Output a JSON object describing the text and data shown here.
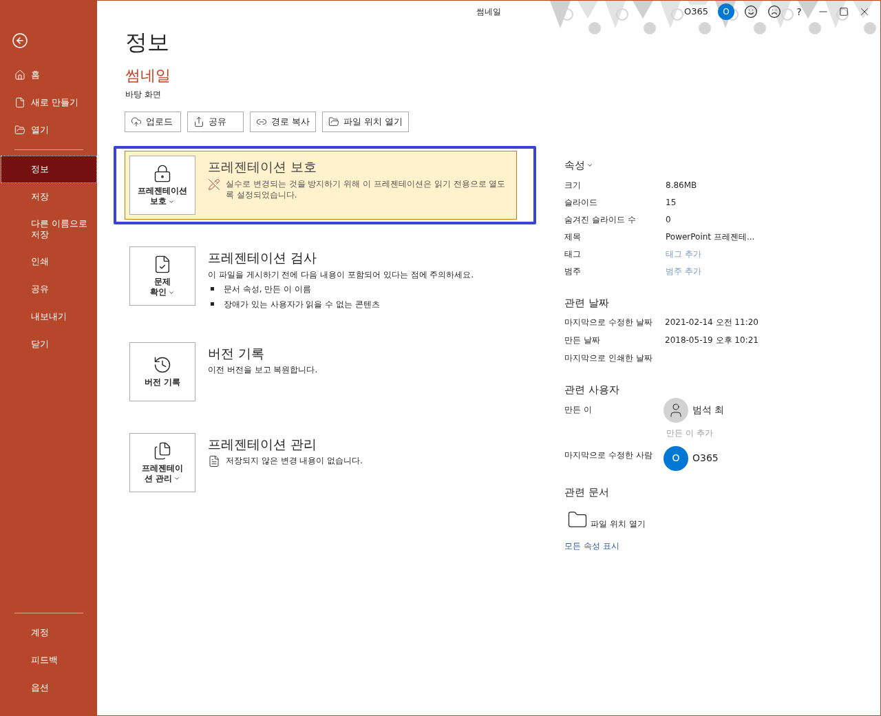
{
  "title_bar": {
    "title": "썸네일",
    "account_name": "O365",
    "account_initial": "O",
    "help": "?"
  },
  "sidebar": {
    "top_items": [
      {
        "label": "홈"
      },
      {
        "label": "새로 만들기"
      },
      {
        "label": "열기"
      }
    ],
    "items": [
      {
        "label": "정보",
        "selected": true
      },
      {
        "label": "저장",
        "selected": false
      },
      {
        "label": "다른 이름으로 저장",
        "selected": false
      },
      {
        "label": "인쇄",
        "selected": false
      },
      {
        "label": "공유",
        "selected": false
      },
      {
        "label": "내보내기",
        "selected": false
      },
      {
        "label": "닫기",
        "selected": false
      }
    ],
    "bottom_items": [
      {
        "label": "계정"
      },
      {
        "label": "피드백"
      },
      {
        "label": "옵션"
      }
    ]
  },
  "main": {
    "heading": "정보",
    "file_name": "썸네일",
    "location": "바탕 화면",
    "actions": [
      {
        "label": "업로드"
      },
      {
        "label": "공유"
      },
      {
        "label": "경로 복사"
      },
      {
        "label": "파일 위치 열기"
      }
    ],
    "sections": [
      {
        "button_lines": [
          "프레젠테이션",
          "보호"
        ],
        "has_menu": true,
        "title": "프레젠테이션 보호",
        "description": "실수로 변경되는 것을 방지하기 위해 이 프레젠테이션은 읽기 전용으로 열도록 설정되었습니다.",
        "warning": true,
        "highlighted": true
      },
      {
        "button_lines": [
          "문제",
          "확인"
        ],
        "has_menu": true,
        "title": "프레젠테이션 검사",
        "description": "이 파일을 게시하기 전에 다음 내용이 포함되어 있다는 점에 주의하세요.",
        "bullets": [
          "문서 속성, 만든 이 이름",
          "장애가 있는 사용자가 읽을 수 없는 콘텐츠"
        ],
        "warning": false,
        "highlighted": false
      },
      {
        "button_lines": [
          "버전 기록"
        ],
        "has_menu": false,
        "title": "버전 기록",
        "description": "이전 버전을 보고 복원합니다.",
        "warning": false,
        "highlighted": false
      },
      {
        "button_lines": [
          "프레젠테이",
          "션 관리"
        ],
        "has_menu": true,
        "title": "프레젠테이션 관리",
        "description": "저장되지 않은 변경 내용이 없습니다.",
        "warning": false,
        "highlighted": false
      }
    ]
  },
  "properties": {
    "heading": "속성",
    "rows": [
      {
        "label": "크기",
        "value": "8.86MB",
        "kind": "text"
      },
      {
        "label": "슬라이드",
        "value": "15",
        "kind": "text"
      },
      {
        "label": "숨겨진 슬라이드 수",
        "value": "0",
        "kind": "text"
      },
      {
        "label": "제목",
        "value": "PowerPoint 프레젠테...",
        "kind": "text"
      },
      {
        "label": "태그",
        "value": "태그 추가",
        "kind": "placeholder"
      },
      {
        "label": "범주",
        "value": "범주 추가",
        "kind": "placeholder"
      }
    ],
    "dates_heading": "관련 날짜",
    "dates": [
      {
        "label": "마지막으로 수정한 날짜",
        "value": "2021-02-14 오전 11:20"
      },
      {
        "label": "만든 날짜",
        "value": "2018-05-19 오후 10:21"
      },
      {
        "label": "마지막으로 인쇄한 날짜"
      }
    ],
    "people_heading": "관련 사용자",
    "author_label": "만든 이",
    "author_name": "범석 최",
    "add_author": "만든 이 추가",
    "modifier_label": "마지막으로 수정한 사람",
    "modifier_initial": "O",
    "modifier_name": "O365",
    "docs_heading": "관련 문서",
    "open_location": "파일 위치 열기",
    "show_all": "모든 속성 표시"
  }
}
